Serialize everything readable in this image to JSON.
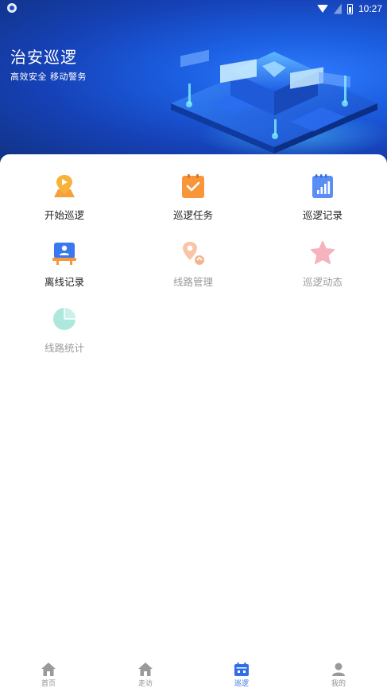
{
  "status_bar": {
    "time": "10:27"
  },
  "header": {
    "title": "治安巡逻",
    "subtitle": "高效安全  移动警务"
  },
  "menu": [
    {
      "label": "开始巡逻",
      "icon": "location-play-icon"
    },
    {
      "label": "巡逻任务",
      "icon": "clipboard-check-icon"
    },
    {
      "label": "巡逻记录",
      "icon": "notebook-chart-icon"
    },
    {
      "label": "离线记录",
      "icon": "id-card-icon"
    },
    {
      "label": "线路管理",
      "icon": "route-pin-icon"
    },
    {
      "label": "巡逻动态",
      "icon": "star-icon"
    },
    {
      "label": "线路统计",
      "icon": "pie-chart-icon"
    }
  ],
  "tabs": [
    {
      "label": "首页",
      "icon": "home-icon"
    },
    {
      "label": "走访",
      "icon": "home-icon"
    },
    {
      "label": "巡逻",
      "icon": "calendar-icon"
    },
    {
      "label": "我的",
      "icon": "user-icon"
    }
  ],
  "colors": {
    "accent": "#2f6ee6",
    "hero": "#1b5ee0",
    "orange": "#f7963b",
    "muted_text": "#9a9a9a"
  }
}
